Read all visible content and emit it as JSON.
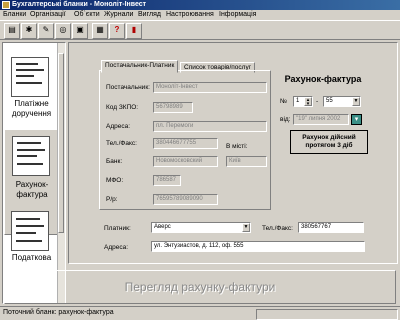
{
  "window": {
    "title": "Бухгалтерські бланки - Моноліт-Інвест"
  },
  "menu": [
    "Бланки",
    "Організації",
    "Об`єкти",
    "Журнали",
    "Вигляд",
    "Настроювання",
    "Інформація"
  ],
  "toolbar_icons": [
    "print-preview-icon",
    "settings-icon",
    "edit-icon",
    "cd-icon",
    "disk-icon",
    "calculator-icon",
    "help-icon",
    "exit-icon"
  ],
  "sidebar": {
    "items": [
      {
        "label_lines": [
          "Платіжне",
          "доручення"
        ]
      },
      {
        "label_lines": [
          "Рахунок-",
          "фактура"
        ]
      },
      {
        "label_lines": [
          "Податкова"
        ]
      }
    ]
  },
  "tabs": [
    "Постачальник-Платник",
    "Список товарів/послуг"
  ],
  "supplier": {
    "name_label": "Постачальник:",
    "name_value": "Моноліт-Інвест",
    "edrpou_label": "Код ЗКПО:",
    "edrpou_value": "56798989",
    "address_label": "Адреса:",
    "address_value": "пл. Перемоги",
    "phone_label": "Тел./Факс:",
    "phone_value": "380446677755",
    "city_label": "В місті:",
    "bank_label": "Банк:",
    "bank_value": "Новомосковский",
    "city_value": "Київ",
    "mfo_label": "МФО:",
    "mfo_value": "786587",
    "account_label": "Р/р:",
    "account_value": "76595789089090"
  },
  "invoice": {
    "heading": "Рахунок-фактура",
    "number_label": "№",
    "number_value": "1",
    "series_value": "55",
    "date_label": "від:",
    "date_value": "\"19\" липня 2002",
    "validity": "Рахунок дійсний протягом 3 діб"
  },
  "payer": {
    "label": "Платник:",
    "value": "Аверс",
    "phone_label": "Тел./Факс:",
    "phone_value": "380567767",
    "address_label": "Адреса:",
    "address_value": "ул. Энтузиастов, д. 112, оф. 555"
  },
  "main_button": "Перегляд рахунку-фактури",
  "status": "Поточний бланк: рахунок-фактура"
}
